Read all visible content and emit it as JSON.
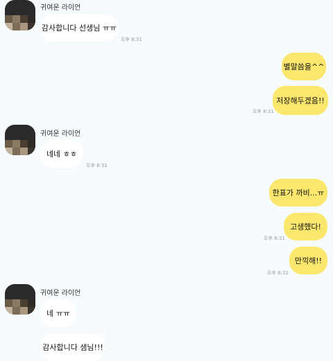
{
  "sender_name": "귀여운 라이언",
  "colors": {
    "background": "#f6fbfd",
    "incoming_bubble": "#ffffff",
    "outgoing_bubble": "#fbe76e"
  },
  "messages": [
    {
      "side": "in",
      "text": "감사합니다 선생님 ㅠㅠ",
      "time": "오후 8:31"
    },
    {
      "side": "out",
      "text": "별말씀을^^"
    },
    {
      "side": "out",
      "text": "저장해두겠음!!",
      "time": "오후 8:31"
    },
    {
      "side": "in",
      "text": "네네 ㅎㅎ",
      "time": "오후 8:31"
    },
    {
      "side": "out",
      "text": "한표가 까비...ㅠ"
    },
    {
      "side": "out",
      "text": "고생했다!",
      "time": "오후 8:31"
    },
    {
      "side": "out",
      "text": "만끽해!!",
      "time": "오후 8:32"
    },
    {
      "side": "in",
      "text": "네 ㅠㅠ"
    },
    {
      "side": "in",
      "text": "감사합니다 샘님!!!"
    }
  ]
}
